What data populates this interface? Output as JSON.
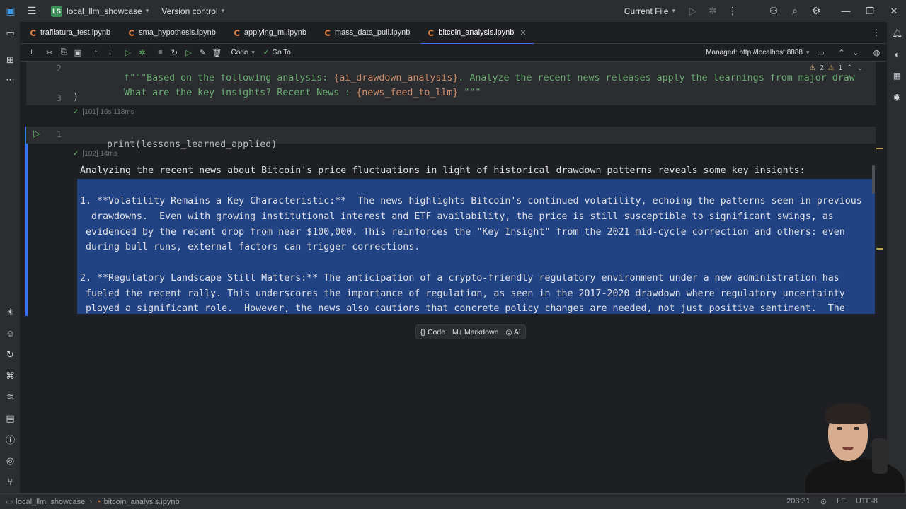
{
  "titlebar": {
    "project_badge": "LS",
    "project_name": "local_llm_showcase",
    "version_control": "Version control",
    "run_config": "Current File"
  },
  "tabs": [
    {
      "label": "trafilatura_test.ipynb"
    },
    {
      "label": "sma_hypothesis.ipynb"
    },
    {
      "label": "applying_ml.ipynb"
    },
    {
      "label": "mass_data_pull.ipynb"
    },
    {
      "label": "bitcoin_analysis.ipynb"
    }
  ],
  "toolbar": {
    "cell_type": "Code",
    "goto": "Go To",
    "managed": "Managed: http://localhost:8888"
  },
  "editor": {
    "warnings": "2",
    "weak_warnings": "1",
    "cell1": {
      "line2_num": "2",
      "line2_prefix": "    f\"\"\"Based on the following analysis: ",
      "line2_var": "{ai_drawdown_analysis}",
      "line2_suffix": ". Analyze the recent news releases apply the learnings from major draw",
      "line2b_prefix": "    What are the key insights? Recent News : ",
      "line2b_var": "{news_feed_to_llm}",
      "line2b_suffix": " \"\"\"",
      "line3_num": "3",
      "line3": ")",
      "exec": "[101] 16s 118ms"
    },
    "cell2": {
      "line_num": "1",
      "code_fn": "print",
      "code_arg": "(lessons_learned_applied)",
      "exec": "[102] 14ms"
    },
    "output": [
      "Analyzing the recent news about Bitcoin's price fluctuations in light of historical drawdown patterns reveals some key insights:",
      "",
      "1. **Volatility Remains a Key Characteristic:**  The news highlights Bitcoin's continued volatility, echoing the patterns seen in previous",
      "  drawdowns.  Even with growing institutional interest and ETF availability, the price is still susceptible to significant swings, as",
      " evidenced by the recent drop from near $100,000. This reinforces the \"Key Insight\" from the 2021 mid-cycle correction and others: even",
      " during bull runs, external factors can trigger corrections.",
      "",
      "2. **Regulatory Landscape Still Matters:** The anticipation of a crypto-friendly regulatory environment under a new administration has",
      " fueled the recent rally. This underscores the importance of regulation, as seen in the 2017-2020 drawdown where regulatory uncertainty",
      " played a significant role.  However, the news also cautions that concrete policy changes are needed, not just positive sentiment.  The"
    ],
    "add_cell": {
      "code": "Code",
      "markdown": "Markdown",
      "ai": "AI"
    }
  },
  "statusbar": {
    "crumb_project": "local_llm_showcase",
    "crumb_file": "bitcoin_analysis.ipynb",
    "position": "203:31",
    "line_sep": "LF",
    "encoding": "UTF-8"
  }
}
